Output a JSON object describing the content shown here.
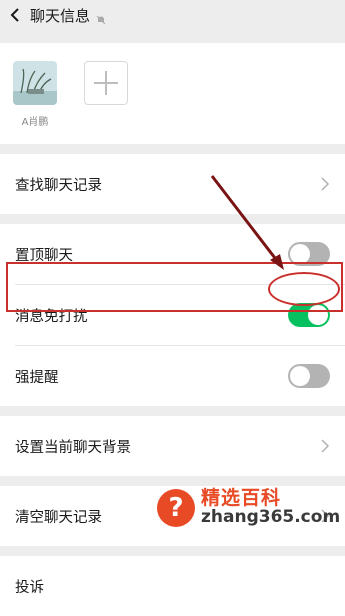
{
  "header": {
    "title": "聊天信息",
    "back_icon": "chevron-left-icon",
    "mute_icon": "bell-muted-icon"
  },
  "members": {
    "avatar_name": "A肖鹏",
    "add_icon": "plus-icon"
  },
  "settings": {
    "find_history": "查找聊天记录",
    "pin_chat": "置顶聊天",
    "mute_notifications": "消息免打扰",
    "strong_reminder": "强提醒",
    "set_background": "设置当前聊天背景",
    "clear_history": "清空聊天记录",
    "report": "投诉"
  },
  "toggles": {
    "pin_chat": false,
    "mute_notifications": true,
    "strong_reminder": false
  },
  "colors": {
    "toggle_on": "#07c160",
    "toggle_off": "#b3b3b3",
    "annotation": "#c9302c"
  },
  "watermark": {
    "brand": "精选百科",
    "url": "zhang365.com",
    "icon": "question-mark-icon"
  }
}
